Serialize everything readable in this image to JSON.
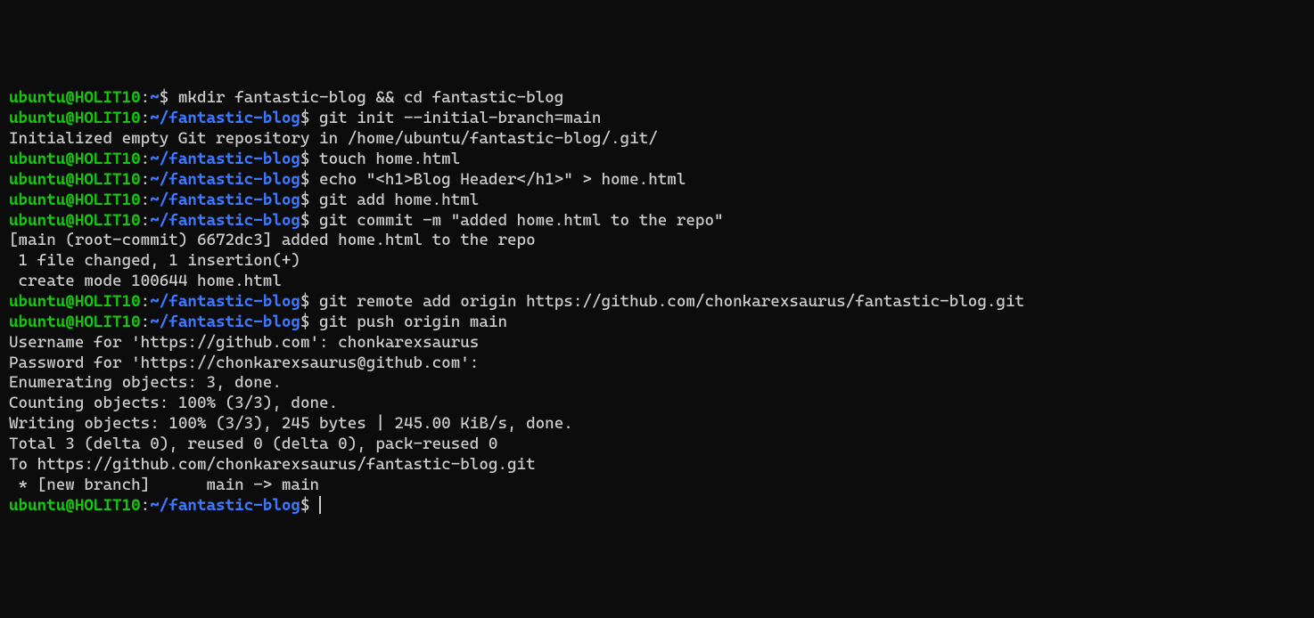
{
  "colors": {
    "user_host": "#16c60c",
    "path": "#3b78ff",
    "text": "#cccccc",
    "background": "#0c0c0c"
  },
  "prompt": {
    "user": "ubuntu",
    "host": "HOLIT10",
    "home_path": "~",
    "blog_path": "~/fantastic-blog",
    "dollar": "$"
  },
  "lines": {
    "l1_cmd": " mkdir fantastic-blog && cd fantastic-blog",
    "l2_cmd": " git init --initial-branch=main",
    "l3_out": "Initialized empty Git repository in /home/ubuntu/fantastic-blog/.git/",
    "l4_cmd": " touch home.html",
    "l5_cmd": " echo \"<h1>Blog Header</h1>\" > home.html",
    "l6_cmd": " git add home.html",
    "l7_cmd": " git commit -m \"added home.html to the repo\"",
    "l8_out": "[main (root-commit) 6672dc3] added home.html to the repo",
    "l9_out": " 1 file changed, 1 insertion(+)",
    "l10_out": " create mode 100644 home.html",
    "l11_cmd": " git remote add origin https://github.com/chonkarexsaurus/fantastic-blog.git",
    "l12_cmd": " git push origin main",
    "l13_out": "Username for 'https://github.com': chonkarexsaurus",
    "l14_out": "Password for 'https://chonkarexsaurus@github.com':",
    "l15_out": "Enumerating objects: 3, done.",
    "l16_out": "Counting objects: 100% (3/3), done.",
    "l17_out": "Writing objects: 100% (3/3), 245 bytes | 245.00 KiB/s, done.",
    "l18_out": "Total 3 (delta 0), reused 0 (delta 0), pack-reused 0",
    "l19_out": "To https://github.com/chonkarexsaurus/fantastic-blog.git",
    "l20_out": " * [new branch]      main -> main",
    "l21_cmd": " "
  }
}
